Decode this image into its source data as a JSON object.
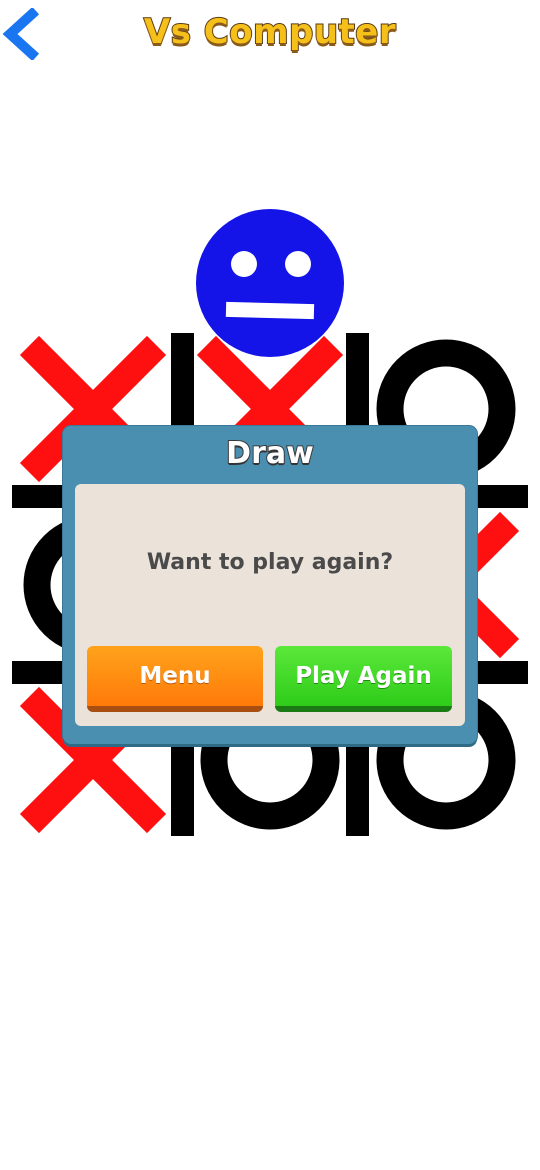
{
  "header": {
    "title": "Vs Computer",
    "back_icon": "chevron-left-icon",
    "accent_color": "#f6c01a",
    "back_color": "#1976f0"
  },
  "board": {
    "cells": [
      "X",
      "X",
      "O",
      "O",
      "",
      "X",
      "X",
      "O",
      "O"
    ],
    "x_color": "#ff1010",
    "o_color": "#000000",
    "grid_color": "#000000"
  },
  "opponent": {
    "icon": "neutral-face-icon",
    "color": "#1414e8"
  },
  "dialog": {
    "title": "Draw",
    "message": "Want to play again?",
    "menu_label": "Menu",
    "play_again_label": "Play Again"
  }
}
